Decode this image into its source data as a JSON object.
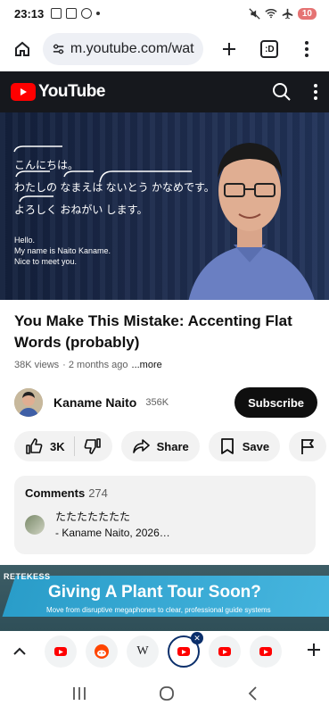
{
  "status_bar": {
    "time": "23:13",
    "battery": "10"
  },
  "browser": {
    "url": "m.youtube.com/watc",
    "tab_count": ":D"
  },
  "youtube": {
    "logo_text": "YouTube"
  },
  "video_overlay": {
    "jp_lines": [
      "こんにちは。",
      "わたしの なまえは ないとう かなめです。",
      "よろしく おねがい します。"
    ],
    "en_lines": [
      "Hello.",
      "My name is Naito Kaname.",
      "Nice to meet you."
    ]
  },
  "video": {
    "title": "You Make This Mistake: Accenting Flat Words (probably)",
    "views": "38K views",
    "age": "· 2 months ago",
    "more": "...more"
  },
  "channel": {
    "name": "Kaname Naito",
    "subscribers": "356K",
    "subscribe_label": "Subscribe"
  },
  "actions": {
    "likes": "3K",
    "share_label": "Share",
    "save_label": "Save"
  },
  "comments": {
    "heading": "Comments",
    "count": "274",
    "top_comment_text": "たたたたたたた",
    "top_comment_author": "- Kaname Naito, 2026…"
  },
  "ad": {
    "brand": "RETEKESS",
    "headline": "Giving A Plant Tour Soon?",
    "subline": "Move from disruptive megaphones to clear, professional guide systems"
  },
  "tabs": {
    "wiki_label": "W"
  },
  "colors": {
    "youtube_red": "#ff0000",
    "header_bg": "#16181d",
    "subscribe_bg": "#0f0f0f",
    "active_tab_ring": "#0b2f6b"
  }
}
